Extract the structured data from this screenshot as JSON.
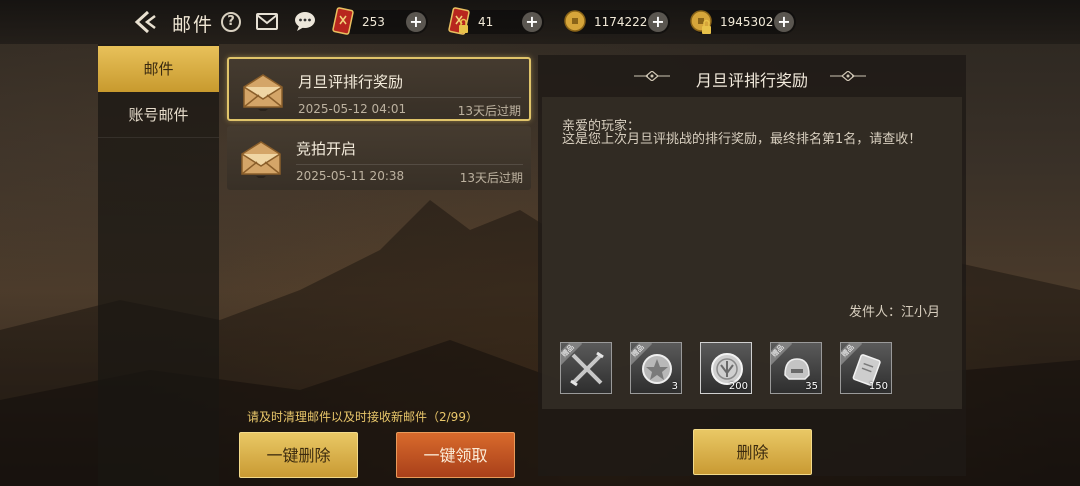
{
  "header": {
    "title": "邮件",
    "help_symbol": "?",
    "currencies": [
      {
        "icon": "red-card-icon",
        "value": "253",
        "plus": "+"
      },
      {
        "icon": "locked-red-card-icon",
        "value": "41",
        "plus": "+"
      },
      {
        "icon": "gold-coin-icon",
        "value": "1174222",
        "plus": "+"
      },
      {
        "icon": "locked-gold-coin-icon",
        "value": "1945302",
        "plus": "+"
      }
    ]
  },
  "sidebar": {
    "tabs": [
      {
        "label": "邮件",
        "active": true
      },
      {
        "label": "账号邮件",
        "active": false
      }
    ]
  },
  "mails": [
    {
      "title": "月旦评排行奖励",
      "date": "2025-05-12  04:01",
      "expiry": "13天后过期",
      "selected": true
    },
    {
      "title": "竞拍开启",
      "date": "2025-05-11  20:38",
      "expiry": "13天后过期",
      "selected": false
    }
  ],
  "notice": "请及时清理邮件以及时接收新邮件（2/99）",
  "buttons": {
    "delete_all": "一键删除",
    "claim_all": "一键领取",
    "delete": "删除"
  },
  "detail": {
    "title": "月旦评排行奖励",
    "greeting": "亲爱的玩家：",
    "content": "这是您上次月旦评挑战的排行奖励，最终排名第1名，请查收！",
    "sender": "发件人：江小月",
    "attachments": [
      {
        "badge": "赠品",
        "icon": "crossed-weapons-icon",
        "qty": ""
      },
      {
        "badge": "赠品",
        "icon": "silver-medal-icon",
        "qty": "3"
      },
      {
        "badge": "",
        "icon": "silver-coin-icon",
        "qty": "200"
      },
      {
        "badge": "赠品",
        "icon": "silver-helmet-icon",
        "qty": "35"
      },
      {
        "badge": "赠品",
        "icon": "silver-ticket-icon",
        "qty": "150"
      }
    ]
  },
  "colors": {
    "accent_gold": "#e0c46a",
    "claim_red": "#c8552a",
    "notice_text": "#e8c66a"
  }
}
